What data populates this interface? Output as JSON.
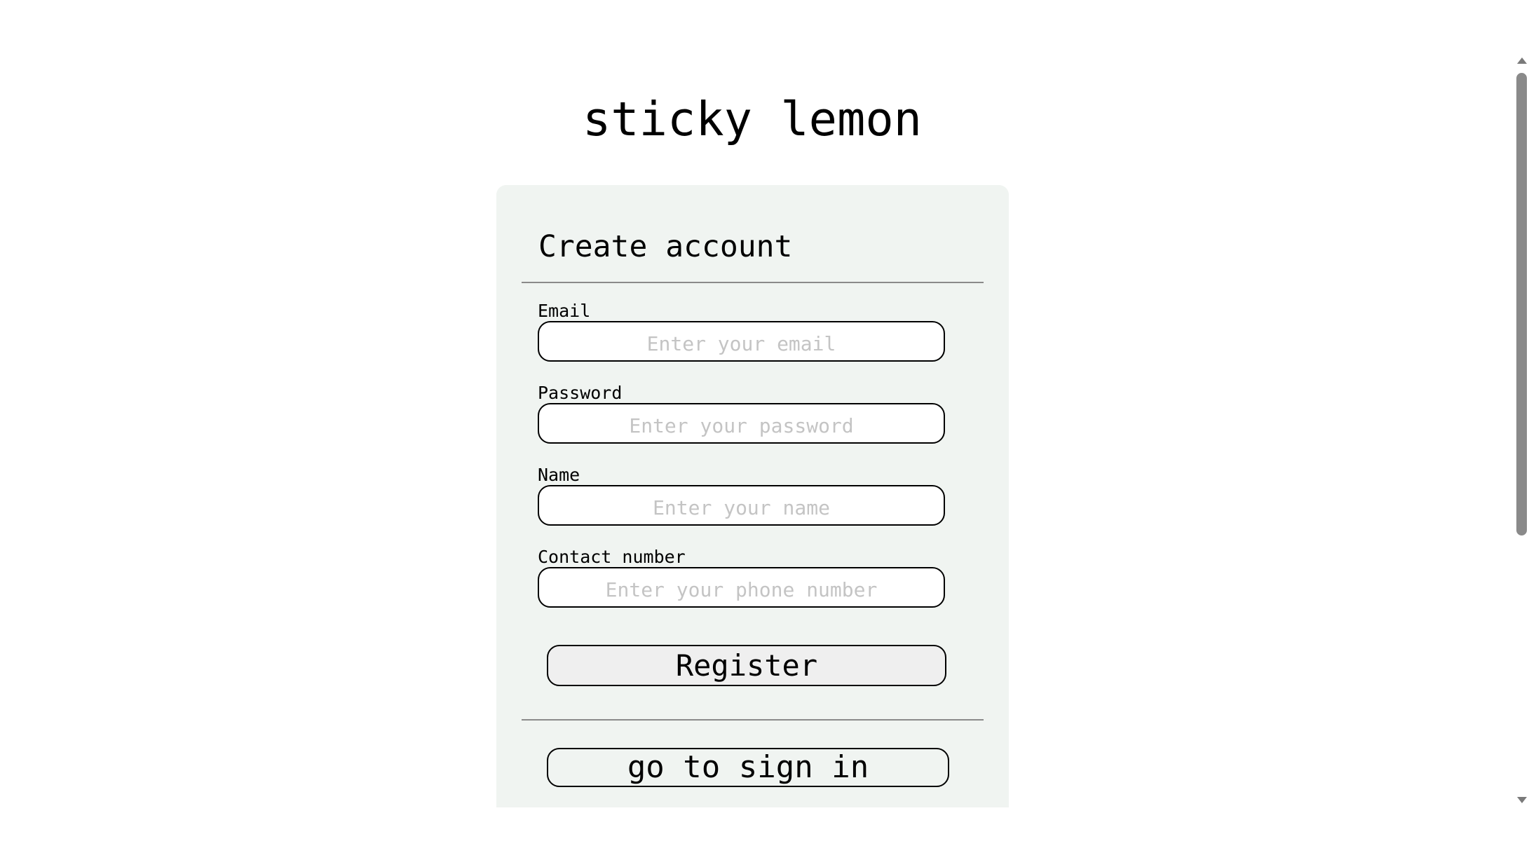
{
  "app": {
    "title": "sticky lemon"
  },
  "form": {
    "heading": "Create account",
    "fields": [
      {
        "label": "Email",
        "placeholder": "Enter your email"
      },
      {
        "label": "Password",
        "placeholder": "Enter your password"
      },
      {
        "label": "Name",
        "placeholder": "Enter your name"
      },
      {
        "label": "Contact number",
        "placeholder": "Enter your phone number"
      }
    ],
    "register_label": "Register",
    "signin_label": "go to sign in"
  },
  "colors": {
    "card_background": "#f0f4f1",
    "button_background": "#efefef",
    "placeholder": "#c4c4c4"
  }
}
